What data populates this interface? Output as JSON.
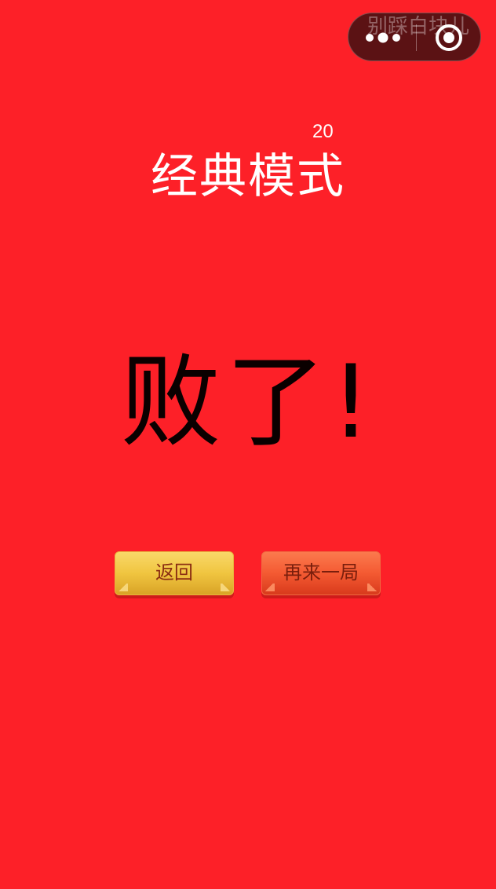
{
  "capsule": {
    "title": "别踩白块儿",
    "more_icon": "more-dots-icon",
    "close_icon": "close-circle-icon"
  },
  "game": {
    "score": "20",
    "mode_title": "经典模式",
    "result_text": "败了!"
  },
  "buttons": {
    "back_label": "返回",
    "retry_label": "再来一局"
  },
  "colors": {
    "background": "#fd2028",
    "back_button": "#f0c540",
    "retry_button": "#f45a32",
    "result_text": "#0a0000",
    "title_text": "#ffffff"
  }
}
